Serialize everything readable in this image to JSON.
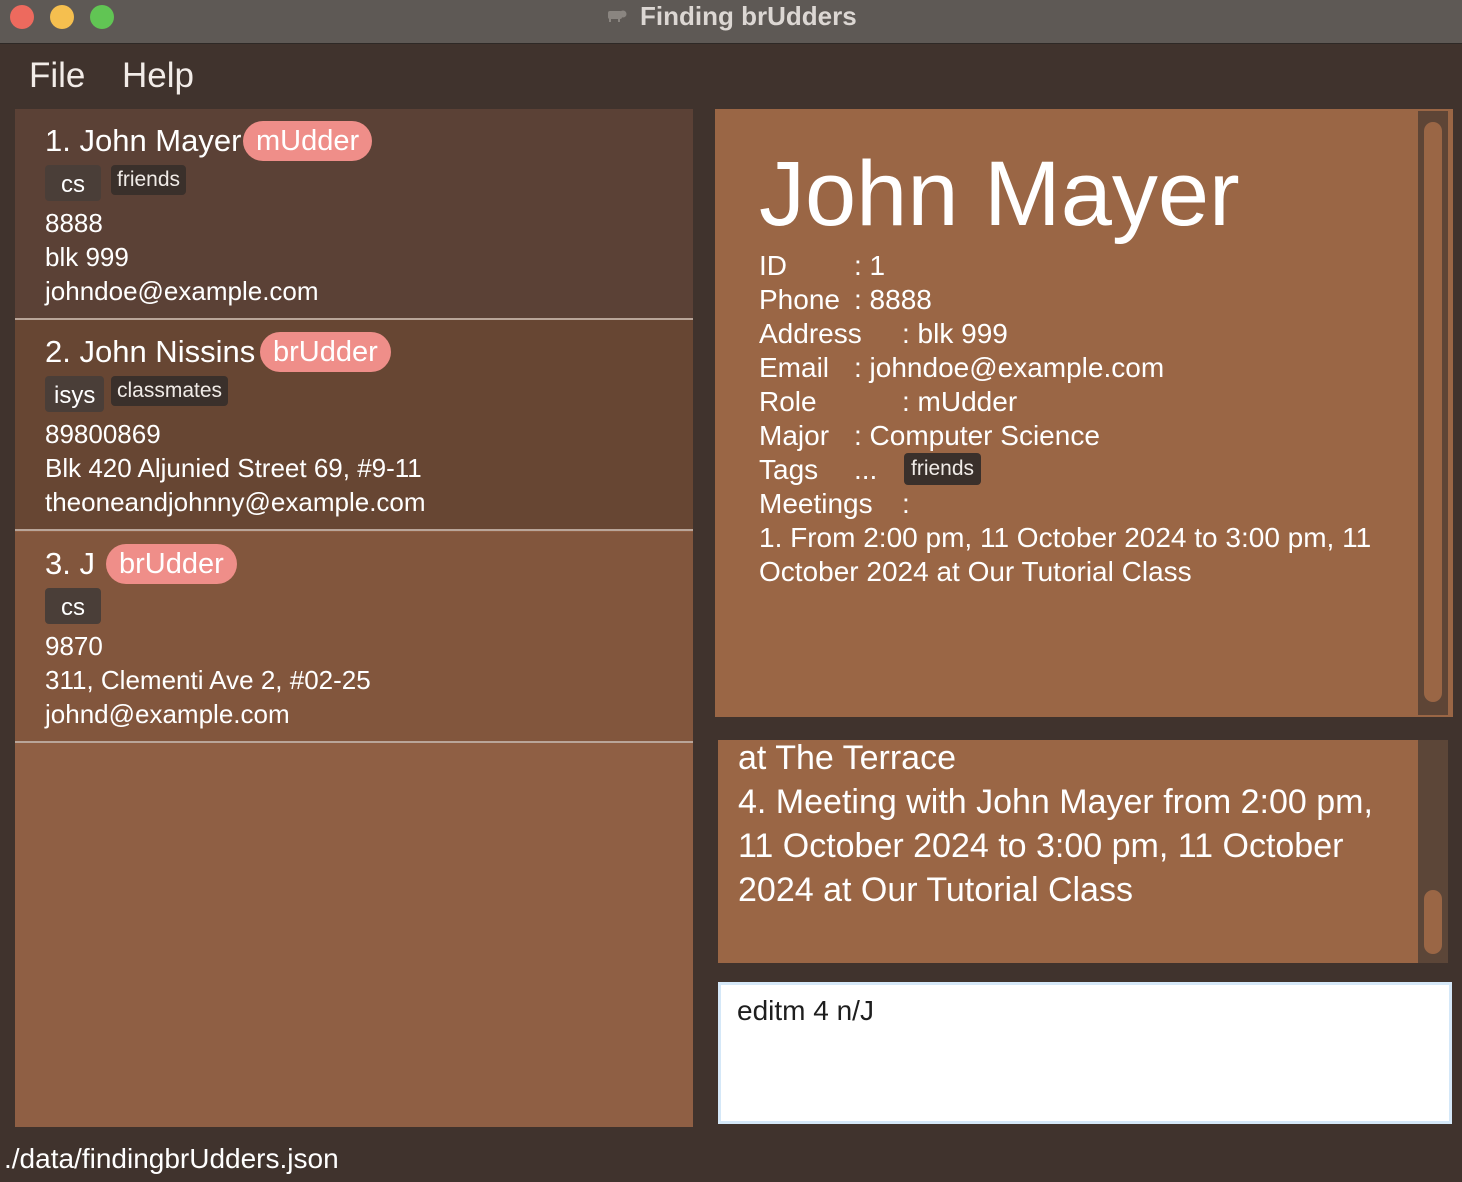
{
  "window": {
    "title": "Finding brUdders"
  },
  "menu": {
    "items": [
      "File",
      "Help"
    ]
  },
  "persons": [
    {
      "index_name": "1. John Mayer",
      "role": "mUdder",
      "major": "cs",
      "tags": [
        "friends"
      ],
      "phone": "8888",
      "address": "blk 999",
      "email": "johndoe@example.com"
    },
    {
      "index_name": "2. John Nissins",
      "role": "brUdder",
      "major": "isys",
      "tags": [
        "classmates"
      ],
      "phone": "89800869",
      "address": "Blk 420 Aljunied Street 69, #9-11",
      "email": "theoneandjohnny@example.com"
    },
    {
      "index_name": "3. J",
      "role": "brUdder",
      "major": "cs",
      "tags": [],
      "phone": "9870",
      "address": "311, Clementi Ave 2, #02-25",
      "email": "johnd@example.com"
    }
  ],
  "detail": {
    "name": "John Mayer",
    "labels": {
      "id": "ID",
      "phone": "Phone",
      "address": "Address",
      "email": "Email",
      "role": "Role",
      "major": "Major",
      "tags": "Tags",
      "meetings": "Meetings"
    },
    "values": {
      "id": ": 1",
      "phone": ": 8888",
      "address": ": blk 999",
      "email": ": johndoe@example.com",
      "role": ": mUdder",
      "major": ": Computer Science",
      "tags": "...",
      "meetings": ":"
    },
    "tag": "friends",
    "meeting_1": "1. From 2:00 pm, 11 October 2024 to 3:00 pm, 11 October 2024 at Our Tutorial Class"
  },
  "result": {
    "line_1": "at The Terrace",
    "line_2": "4. Meeting with John Mayer from 2:00 pm, 11 October 2024 to 3:00 pm, 11 October 2024 at Our Tutorial Class"
  },
  "command": {
    "value": "editm 4 n/J"
  },
  "status": {
    "path": "./data/findingbrUdders.json"
  },
  "colors": {
    "background": "#40332d",
    "role_badge": "#ef8e89",
    "panel_brown": "#9a6645",
    "selected_card": "#5b4136"
  }
}
